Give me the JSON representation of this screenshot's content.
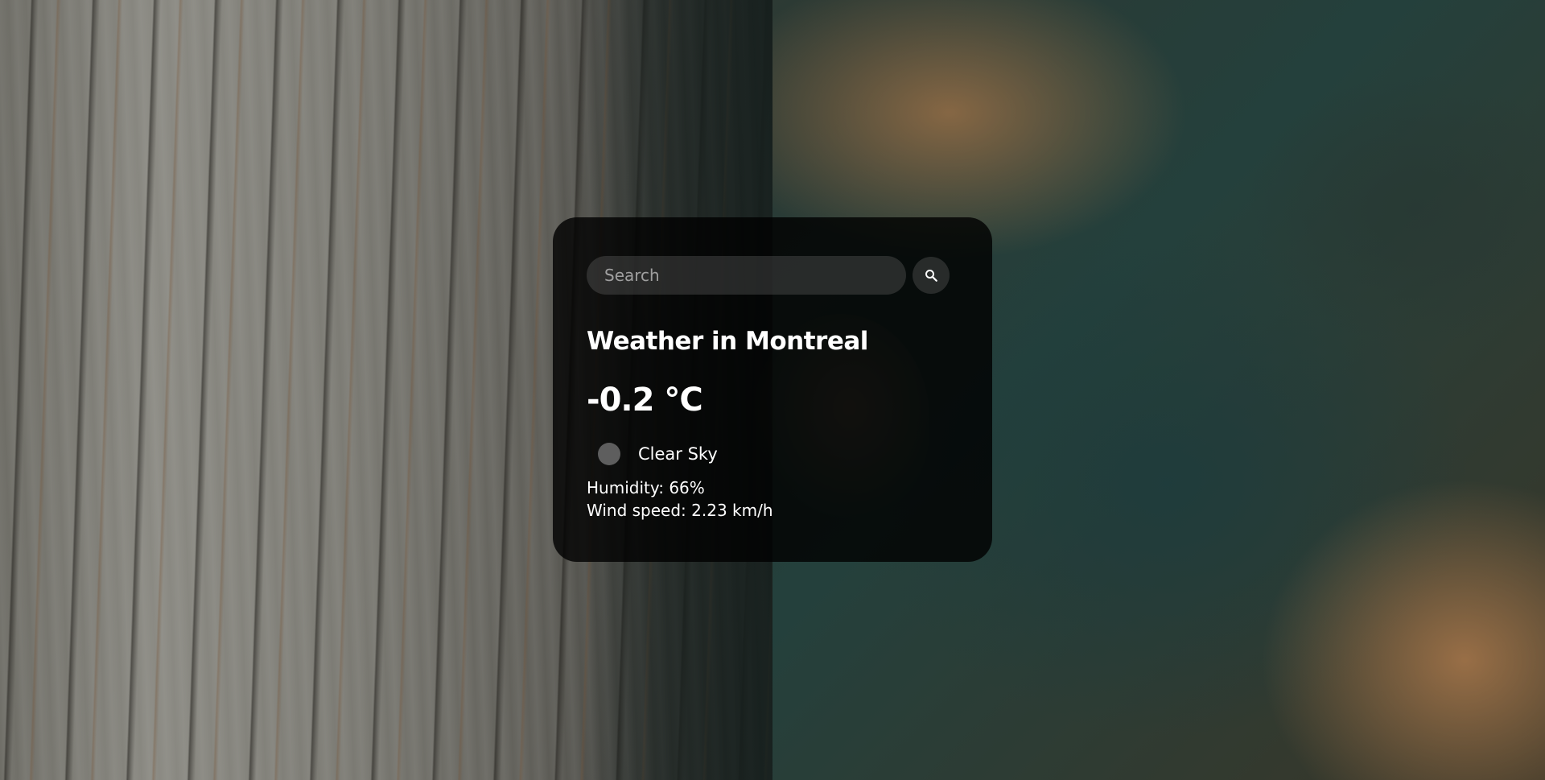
{
  "search": {
    "placeholder": "Search",
    "value": ""
  },
  "weather": {
    "title": "Weather in Montreal",
    "temperature": "-0.2 °C",
    "description": "Clear Sky",
    "humidity": "Humidity: 66%",
    "wind": "Wind speed: 2.23 km/h"
  },
  "icons": {
    "search": "search-icon",
    "weather": "weather-icon"
  },
  "colors": {
    "card_bg": "#000000",
    "text": "#ffffff",
    "input_bg": "#7c7c7c"
  }
}
